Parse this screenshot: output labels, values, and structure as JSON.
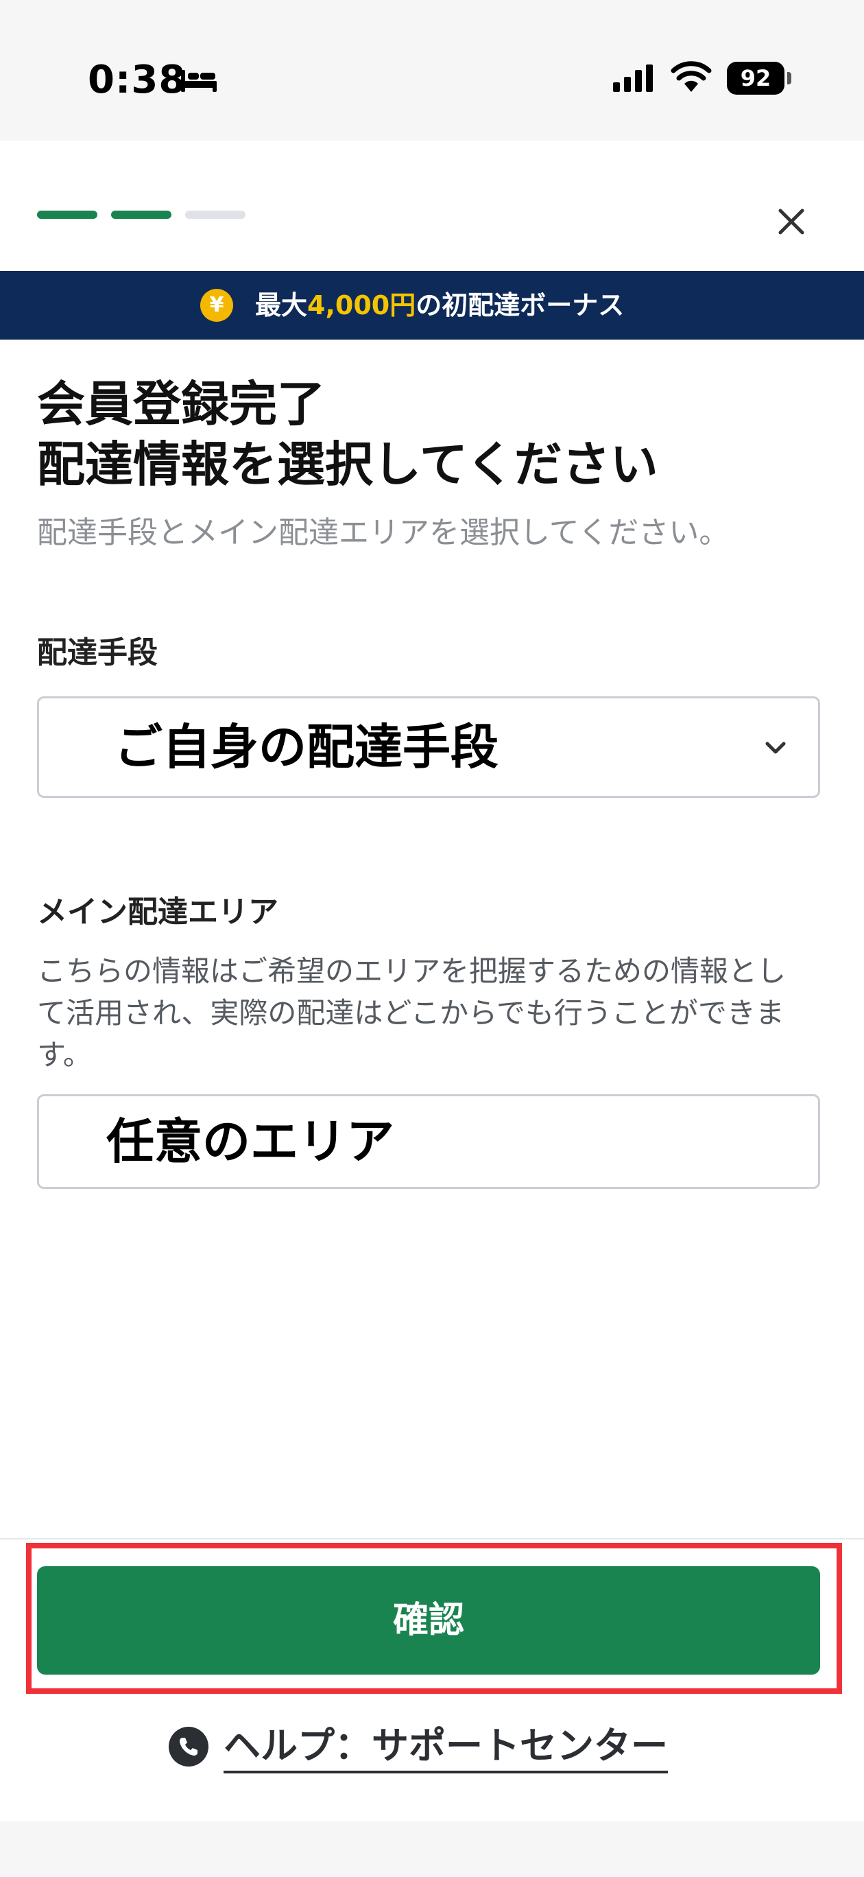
{
  "status_bar": {
    "time": "0:38",
    "battery": "92"
  },
  "progress": {
    "current_step": 2,
    "total_steps": 3
  },
  "banner": {
    "prefix": "最大",
    "amount": "4,000円",
    "suffix": "の初配達ボーナス",
    "icon_symbol": "¥"
  },
  "title": {
    "line1": "会員登録完了",
    "line2": "配達情報を選択してください"
  },
  "subtitle": "配達手段とメイン配達エリアを選択してください。",
  "delivery_method": {
    "label": "配達手段",
    "value": "ご自身の配達手段"
  },
  "main_area": {
    "label": "メイン配達エリア",
    "description": "こちらの情報はご希望のエリアを把握するための情報として活用され、実際の配達はどこからでも行うことができます。",
    "value": "任意のエリア"
  },
  "confirm_button": "確認",
  "help_link": "ヘルプ：サポートセンター",
  "colors": {
    "primary_green": "#1a8450",
    "banner_navy": "#0e2a58",
    "banner_highlight": "#f5c400",
    "highlight_frame": "#f0313a"
  },
  "icons": [
    "bed-icon",
    "signal-icon",
    "wifi-icon",
    "battery-icon",
    "close-icon",
    "yen-icon",
    "chevron-down-icon",
    "phone-icon"
  ]
}
